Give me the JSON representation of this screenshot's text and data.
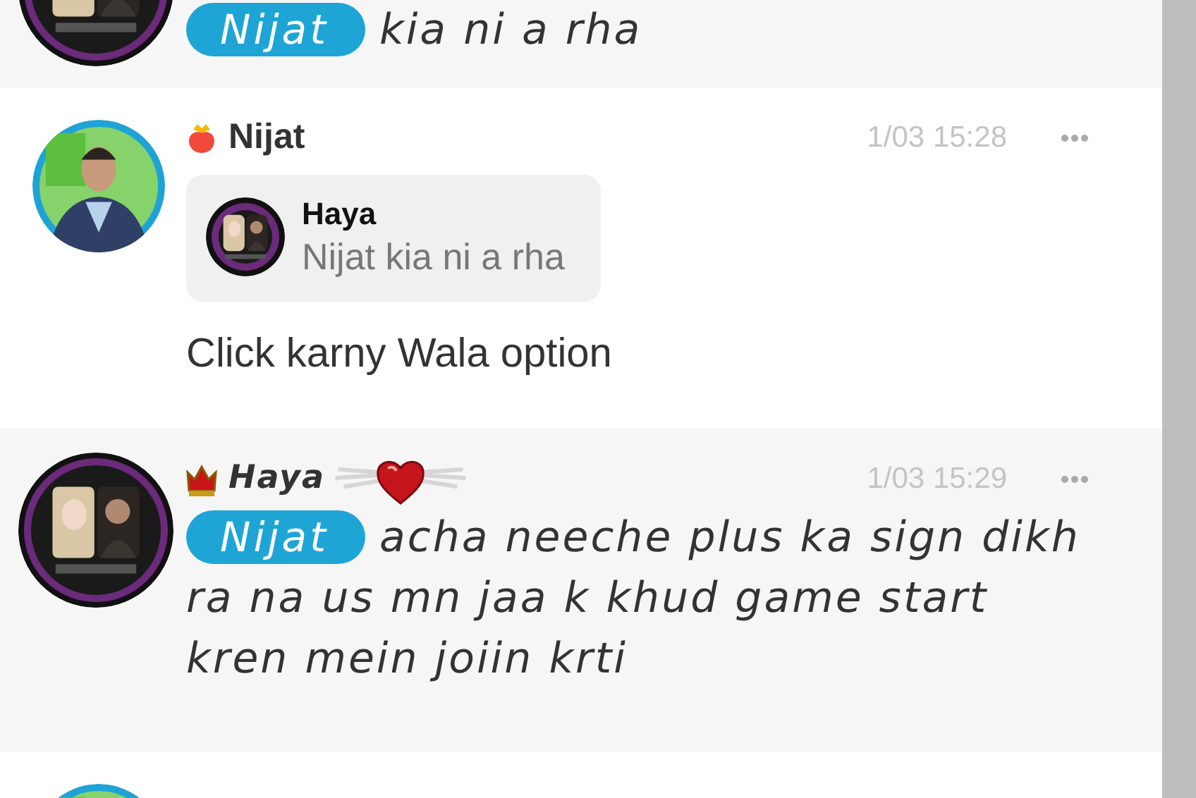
{
  "messages": [
    {
      "kind": "fancy",
      "mention": "Nijat",
      "text": "kia ni a rha"
    },
    {
      "kind": "plain",
      "name": "Nijat",
      "time": "1/03 15:28",
      "quote": {
        "name": "Haya",
        "text": "Nijat kia ni a rha"
      },
      "text": "Click karny Wala option"
    },
    {
      "kind": "fancy",
      "name": "Haya",
      "time": "1/03 15:29",
      "mention": "Nijat",
      "text": "acha neeche plus ka sign dikh ra na us mn jaa k khud game start kren mein joiin krti"
    },
    {
      "kind": "plain"
    }
  ]
}
